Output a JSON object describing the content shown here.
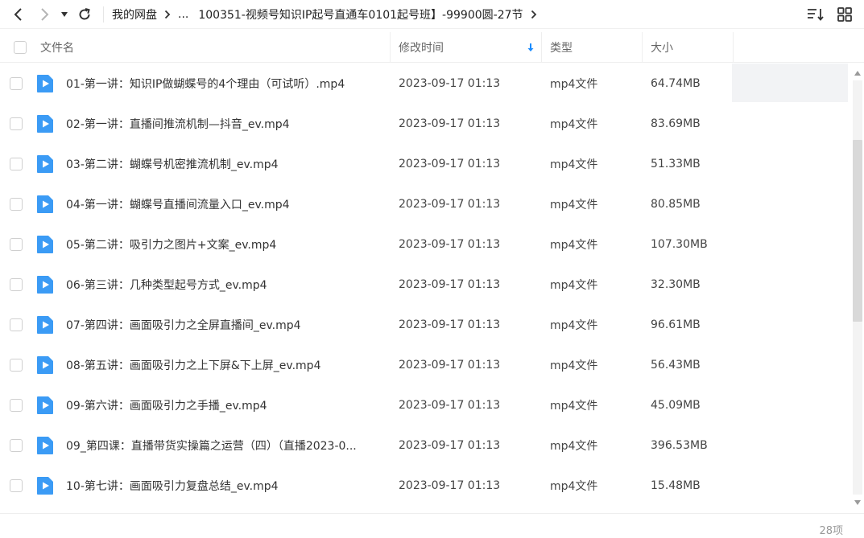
{
  "toolbar": {
    "breadcrumb": [
      "我的网盘",
      "...",
      "100351-视频号知识IP起号直通车0101起号班】-99900圆-27节"
    ]
  },
  "header": {
    "name": "文件名",
    "modified": "修改时间",
    "type": "类型",
    "size": "大小"
  },
  "files": [
    {
      "name": "01-第一讲：知识IP做蝴蝶号的4个理由（可试听）.mp4",
      "modified": "2023-09-17 01:13",
      "type": "mp4文件",
      "size": "64.74MB"
    },
    {
      "name": "02-第一讲：直播间推流机制—抖音_ev.mp4",
      "modified": "2023-09-17 01:13",
      "type": "mp4文件",
      "size": "83.69MB"
    },
    {
      "name": "03-第二讲：蝴蝶号机密推流机制_ev.mp4",
      "modified": "2023-09-17 01:13",
      "type": "mp4文件",
      "size": "51.33MB"
    },
    {
      "name": "04-第一讲：蝴蝶号直播间流量入口_ev.mp4",
      "modified": "2023-09-17 01:13",
      "type": "mp4文件",
      "size": "80.85MB"
    },
    {
      "name": "05-第二讲：吸引力之图片+文案_ev.mp4",
      "modified": "2023-09-17 01:13",
      "type": "mp4文件",
      "size": "107.30MB"
    },
    {
      "name": "06-第三讲：几种类型起号方式_ev.mp4",
      "modified": "2023-09-17 01:13",
      "type": "mp4文件",
      "size": "32.30MB"
    },
    {
      "name": "07-第四讲：画面吸引力之全屏直播间_ev.mp4",
      "modified": "2023-09-17 01:13",
      "type": "mp4文件",
      "size": "96.61MB"
    },
    {
      "name": "08-第五讲：画面吸引力之上下屏&下上屏_ev.mp4",
      "modified": "2023-09-17 01:13",
      "type": "mp4文件",
      "size": "56.43MB"
    },
    {
      "name": "09-第六讲：画面吸引力之手播_ev.mp4",
      "modified": "2023-09-17 01:13",
      "type": "mp4文件",
      "size": "45.09MB"
    },
    {
      "name": "09_第四课：直播带货实操篇之运营（四）（直播2023-0...",
      "modified": "2023-09-17 01:13",
      "type": "mp4文件",
      "size": "396.53MB"
    },
    {
      "name": "10-第七讲：画面吸引力复盘总结_ev.mp4",
      "modified": "2023-09-17 01:13",
      "type": "mp4文件",
      "size": "15.48MB"
    }
  ],
  "footer": {
    "count": "28项"
  },
  "colors": {
    "accent": "#1a8cff",
    "icon_blue": "#3b9bf5",
    "hover_bg": "#f2f3f5"
  },
  "icons": [
    "back-icon",
    "forward-icon",
    "dropdown-icon",
    "refresh-icon",
    "sort-icon",
    "grid-view-icon",
    "video-file-icon",
    "sort-desc-icon"
  ]
}
